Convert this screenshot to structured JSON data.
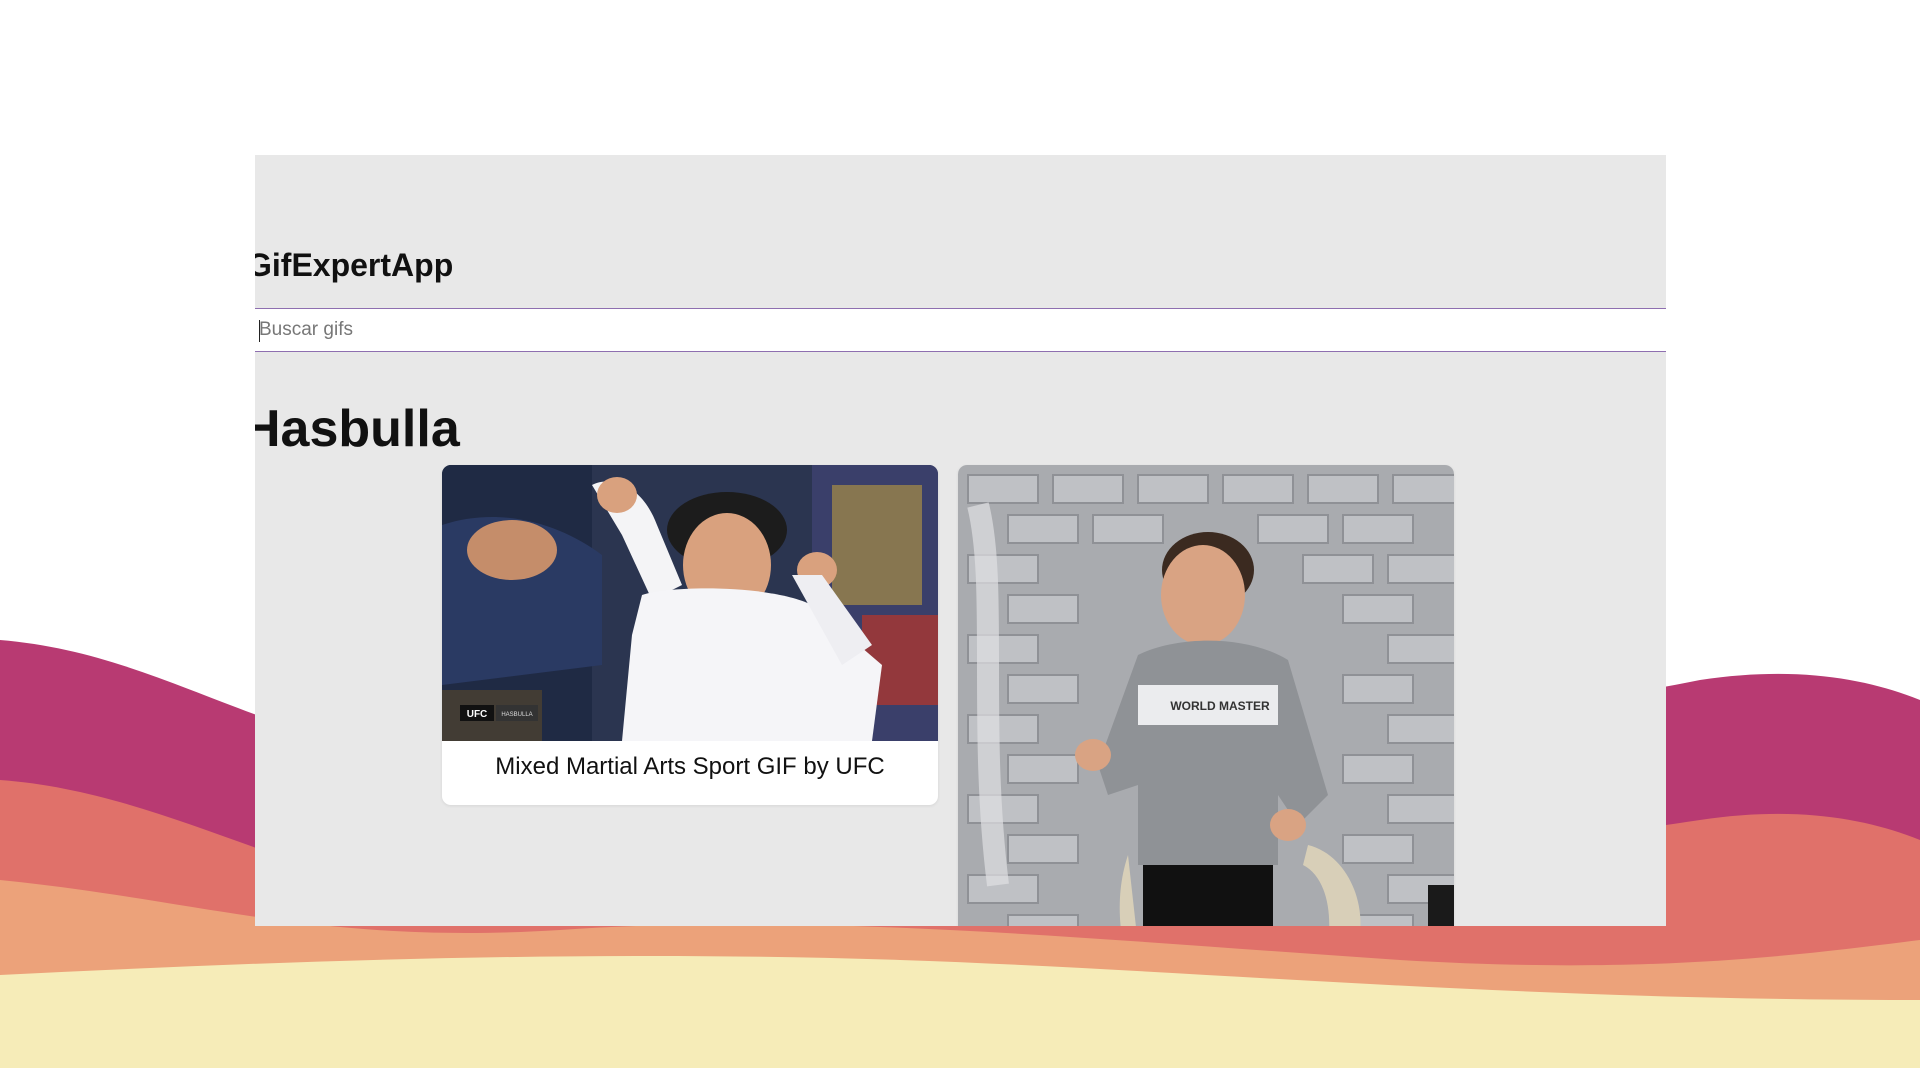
{
  "app": {
    "title": "GifExpertApp"
  },
  "search": {
    "placeholder": "Buscar gifs",
    "value": ""
  },
  "categories": [
    {
      "name": "Hasbulla",
      "gifs": [
        {
          "title": "Mixed Martial Arts Sport GIF by UFC",
          "image_alt": "Mixed Martial Arts Sport GIF by UFC",
          "overlay_logo": "UFC",
          "overlay_tag": "HASBULLA"
        },
        {
          "title": "",
          "image_alt": "Hasbulla dancing GIF",
          "shirt_text": "WORLD MASTER"
        }
      ]
    }
  ],
  "colors": {
    "app_background": "#e8e8e8",
    "input_border": "#8e6fb0",
    "wave_magenta": "#b83a72",
    "wave_coral": "#e0716a",
    "wave_orange": "#eca27a",
    "wave_cream": "#f6ecb8"
  }
}
